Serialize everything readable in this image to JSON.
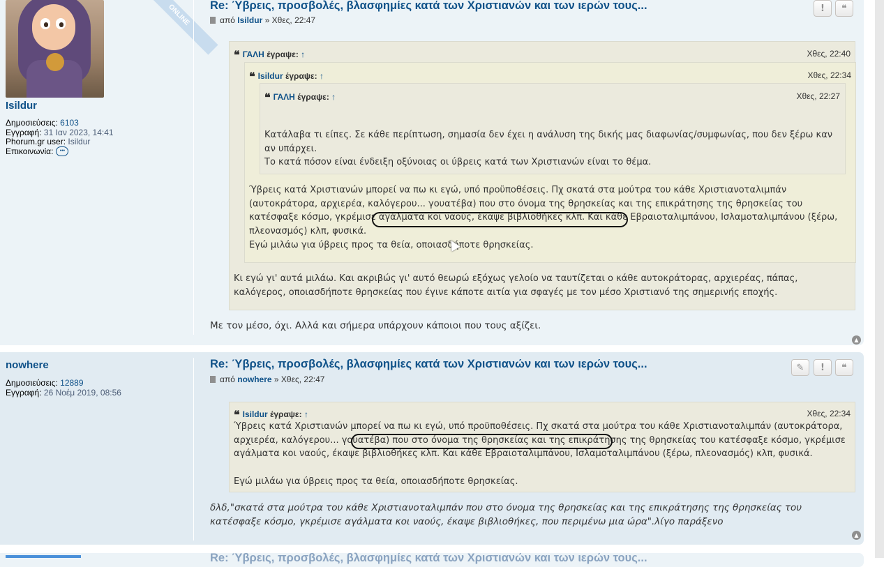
{
  "post1": {
    "author": {
      "name": "Isildur",
      "online_label": "ONLINE",
      "posts_label": "Δημοσιεύσεις:",
      "posts_value": "6103",
      "joined_label": "Εγγραφή:",
      "joined_value": "31 Ιαν 2023, 14:41",
      "phorum_label": "Phorum.gr user:",
      "phorum_value": "Isildur",
      "contact_label": "Επικοινωνία:"
    },
    "title": "Re: Ύβρεις, προσβολές, βλασφημίες κατά των Χριστιανών και των ιερών τους...",
    "by_label": "από",
    "by_name": "Isildur",
    "time": "» Χθες, 22:47",
    "buttons": {
      "report": "!",
      "quote": "❝"
    },
    "quote1": {
      "name": "ΓΑΛΗ",
      "wrote": "έγραψε:",
      "up": "↑",
      "time": "Χθες, 22:40",
      "text1": "Κι εγώ γι' αυτά μιλάω. Και ακριβώς γι' αυτό θεωρώ εξόχως γελοίο να ταυτίζεται ο κάθε αυτοκράτορας, αρχιερέας, πάπας, καλόγερος, οποιασδήποτε θρησκείας που έγινε κάποτε αιτία για σφαγές με τον μέσο Χριστιανό της σημερινής εποχής."
    },
    "quote2": {
      "name": "Isildur",
      "wrote": "έγραψε:",
      "up": "↑",
      "time": "Χθες, 22:34",
      "text_a": "Ύβρεις κατά Χριστιανών μπορεί να πω κι εγώ, υπό προϋποθέσεις. Πχ σκατά στα μούτρα του κάθε Χριστιανοταλιμπάν (αυτοκράτορα, αρχιερέα, καλόγερου... γουατέβα) που στο όνομα της θρησκείας και της επικράτησης της θρησκείας του κατέσφαξε κόσμο, γκρέμισε αγάλματα κοι ναούς, έκαψε βιβλιοθήκες κλπ. Και κάθε Εβραιοταλιμπάνου, Ισλαμοταλιμπάνου (ξέρω, πλεονασμός) κλπ, φυσικά.",
      "text_b": "Εγώ μιλάω για ύβρεις προς τα θεία, οποιασδήποτε θρησκείας."
    },
    "quote3": {
      "name": "ΓΑΛΗ",
      "wrote": "έγραψε:",
      "up": "↑",
      "time": "Χθες, 22:27",
      "text_a": "Κατάλαβα τι είπες. Σε κάθε περίπτωση, σημασία δεν έχει η ανάλυση της δικής μας διαφωνίας/συμφωνίας, που δεν ξέρω καν αν υπάρχει.",
      "text_b": "Το κατά πόσον είναι ένδειξη οξύνοιας οι ύβρεις κατά των Χριστιανών είναι το θέμα."
    },
    "body": "Με τον μέσο, όχι. Αλλά και σήμερα υπάρχουν κάποιοι που τους αξίζει."
  },
  "post2": {
    "author": {
      "name": "nowhere",
      "posts_label": "Δημοσιεύσεις:",
      "posts_value": "12889",
      "joined_label": "Εγγραφή:",
      "joined_value": "26 Νοέμ 2019, 08:56"
    },
    "title": "Re: Ύβρεις, προσβολές, βλασφημίες κατά των Χριστιανών και των ιερών τους...",
    "by_label": "από",
    "by_name": "nowhere",
    "time": "» Χθες, 22:47",
    "buttons": {
      "edit": "✎",
      "report": "!",
      "quote": "❝"
    },
    "quote1": {
      "name": "Isildur",
      "wrote": "έγραψε:",
      "up": "↑",
      "time": "Χθες, 22:34",
      "text_a": "Ύβρεις κατά Χριστιανών μπορεί να πω κι εγώ, υπό προϋποθέσεις. Πχ σκατά στα μούτρα του κάθε Χριστιανοταλιμπάν (αυτοκράτορα, αρχιερέα, καλόγερου... γουατέβα) που στο όνομα της θρησκείας και της επικράτησης της θρησκείας του κατέσφαξε κόσμο, γκρέμισε αγάλματα κοι ναούς, έκαψε βιβλιοθήκες κλπ. Και κάθε Εβραιοταλιμπάνου, Ισλαμοταλιμπάνου (ξέρω, πλεονασμός) κλπ, φυσικά.",
      "text_b": "Εγώ μιλάω για ύβρεις προς τα θεία, οποιασδήποτε θρησκείας."
    },
    "body": "δλδ,\"σκατά στα μούτρα του κάθε Χριστιανοταλιμπάν που στο όνομα της θρησκείας και της επικράτησης της θρησκείας του κατέσφαξε κόσμο, γκρέμισε αγάλματα κοι ναούς, έκαψε βιβλιοθήκες, που περιμένω μια ώρα\".λίγο παράξενο"
  },
  "post3": {
    "title": "Re: Ύβρεις, προσβολές, βλασφημίες κατά των Χριστιανών και των ιερών τους..."
  },
  "icons": {
    "back_to_top": "▲",
    "quote_mark": "❝"
  }
}
